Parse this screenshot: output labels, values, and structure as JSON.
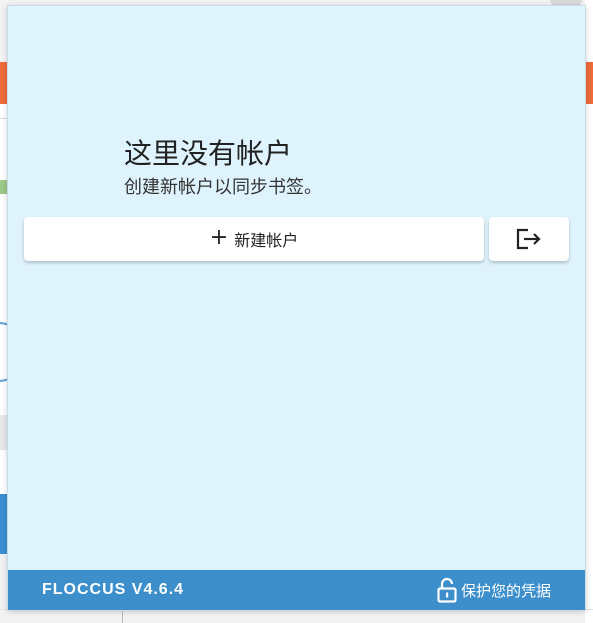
{
  "empty_state": {
    "title": "这里没有帐户",
    "subtitle": "创建新帐户以同步书签。"
  },
  "actions": {
    "new_account_icon": "plus-icon",
    "new_account_label": "新建帐户",
    "import_export_icon": "logout-arrow-icon"
  },
  "footer": {
    "version": "FLOCCUS V4.6.4",
    "secure_icon": "unlocked-padlock-icon",
    "secure_label": "保护您的凭据"
  },
  "colors": {
    "popup_background": "#dff3fd",
    "footer_background": "#3c8fcb",
    "button_background": "#ffffff"
  }
}
